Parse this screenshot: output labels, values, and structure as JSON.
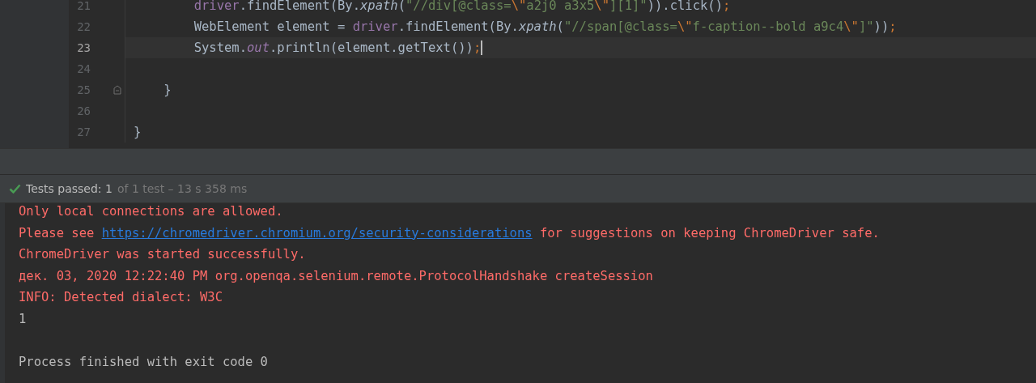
{
  "editor": {
    "lines": [
      {
        "number": "21",
        "current": false,
        "fold": false,
        "tokens": [
          {
            "kind": "field",
            "text": "        driver"
          },
          {
            "kind": "plain",
            "text": ".findElement(By."
          },
          {
            "kind": "italic",
            "text": "xpath"
          },
          {
            "kind": "plain",
            "text": "("
          },
          {
            "kind": "string",
            "text": "\"//div[@class="
          },
          {
            "kind": "escape",
            "text": "\\\""
          },
          {
            "kind": "string",
            "text": "a2j0 a3x5"
          },
          {
            "kind": "escape",
            "text": "\\\""
          },
          {
            "kind": "string",
            "text": "][1]\""
          },
          {
            "kind": "plain",
            "text": ")).click()"
          },
          {
            "kind": "escape",
            "text": ";"
          }
        ]
      },
      {
        "number": "22",
        "current": false,
        "fold": false,
        "tokens": [
          {
            "kind": "plain",
            "text": "        WebElement element = "
          },
          {
            "kind": "field",
            "text": "driver"
          },
          {
            "kind": "plain",
            "text": ".findElement(By."
          },
          {
            "kind": "italic",
            "text": "xpath"
          },
          {
            "kind": "plain",
            "text": "("
          },
          {
            "kind": "string",
            "text": "\"//span[@class="
          },
          {
            "kind": "escape",
            "text": "\\\""
          },
          {
            "kind": "string",
            "text": "f-caption--bold a9c4"
          },
          {
            "kind": "escape",
            "text": "\\\""
          },
          {
            "kind": "string",
            "text": "]\""
          },
          {
            "kind": "plain",
            "text": "))"
          },
          {
            "kind": "escape",
            "text": ";"
          }
        ]
      },
      {
        "number": "23",
        "current": true,
        "fold": false,
        "tokens": [
          {
            "kind": "plain",
            "text": "        System."
          },
          {
            "kind": "italicfield",
            "text": "out"
          },
          {
            "kind": "plain",
            "text": ".println(element.getText())"
          },
          {
            "kind": "escape",
            "text": ";"
          }
        ]
      },
      {
        "number": "24",
        "current": false,
        "fold": false
      },
      {
        "number": "25",
        "current": false,
        "fold": true,
        "tokens": [
          {
            "kind": "plain",
            "text": "    }"
          }
        ]
      },
      {
        "number": "26",
        "current": false,
        "fold": false
      },
      {
        "number": "27",
        "current": false,
        "fold": false,
        "tokens": [
          {
            "kind": "plain",
            "text": "}"
          }
        ]
      }
    ]
  },
  "test_status": {
    "label": "Tests passed:",
    "count": "1",
    "detail": "of 1 test – 13 s 358 ms"
  },
  "console": {
    "lines": [
      {
        "kind": "text",
        "segments": [
          {
            "kind": "error",
            "text": "Only local connections are allowed."
          }
        ]
      },
      {
        "kind": "text",
        "segments": [
          {
            "kind": "error",
            "text": "Please see "
          },
          {
            "kind": "link",
            "text": "https://chromedriver.chromium.org/security-considerations"
          },
          {
            "kind": "error",
            "text": " for suggestions on keeping ChromeDriver safe."
          }
        ]
      },
      {
        "kind": "text",
        "segments": [
          {
            "kind": "error",
            "text": "ChromeDriver was started successfully."
          }
        ]
      },
      {
        "kind": "text",
        "segments": [
          {
            "kind": "error",
            "text": "дек. 03, 2020 12:22:40 PM org.openqa.selenium.remote.ProtocolHandshake createSession"
          }
        ]
      },
      {
        "kind": "text",
        "segments": [
          {
            "kind": "error",
            "text": "INFO: Detected dialect: W3C"
          }
        ]
      },
      {
        "kind": "text",
        "segments": [
          {
            "kind": "output",
            "text": "1"
          }
        ]
      },
      {
        "kind": "blank"
      },
      {
        "kind": "text",
        "segments": [
          {
            "kind": "output",
            "text": "Process finished with exit code 0"
          }
        ]
      }
    ]
  }
}
